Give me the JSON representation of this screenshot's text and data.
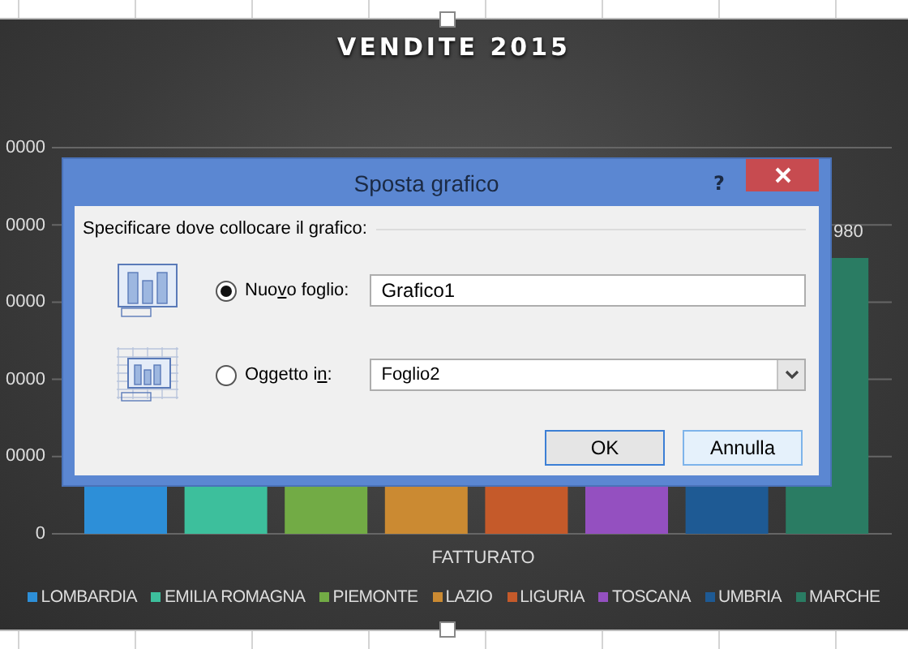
{
  "chart": {
    "title": "VENDITE 2015",
    "y_tick_labels": [
      "0000",
      "0000",
      "0000",
      "0000",
      "0000",
      "0"
    ],
    "data_label": "980",
    "axis_label": "FATTURATO",
    "legend": [
      {
        "label": "LOMBARDIA",
        "color": "#2d8fd8"
      },
      {
        "label": "EMILIA ROMAGNA",
        "color": "#3dbf9c"
      },
      {
        "label": "PIEMONTE",
        "color": "#72ab45"
      },
      {
        "label": "LAZIO",
        "color": "#cb8a32"
      },
      {
        "label": "LIGURIA",
        "color": "#c55a2a"
      },
      {
        "label": "TOSCANA",
        "color": "#9450c0"
      },
      {
        "label": "UMBRIA",
        "color": "#1e5a94"
      },
      {
        "label": "MARCHE",
        "color": "#2a7c63"
      }
    ]
  },
  "dialog": {
    "title": "Sposta grafico",
    "help": "?",
    "group_label": "Specificare dove collocare il grafico:",
    "options": [
      {
        "kind": "text",
        "label": [
          {
            "text": "Nuo",
            "underlined": false
          },
          {
            "text": "v",
            "underlined": true
          },
          {
            "text": "o foglio:",
            "underlined": false
          }
        ],
        "selected": true,
        "value": "Grafico1"
      },
      {
        "kind": "dropdown",
        "label": [
          {
            "text": "Oggetto i",
            "underlined": false
          },
          {
            "text": "n",
            "underlined": true
          },
          {
            "text": ":",
            "underlined": false
          }
        ],
        "selected": false,
        "value": "Foglio2"
      }
    ],
    "buttons": [
      {
        "label": "OK",
        "default": true
      },
      {
        "label": "Annulla",
        "default": false
      }
    ]
  }
}
